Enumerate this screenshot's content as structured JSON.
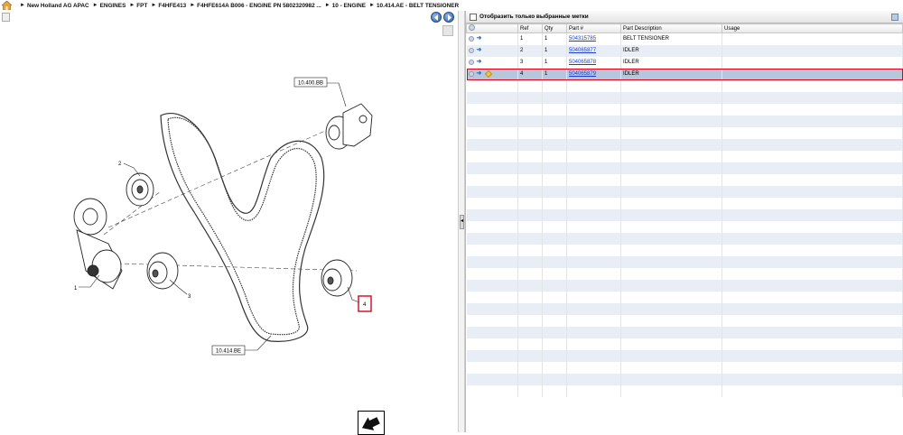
{
  "breadcrumb": {
    "items": [
      "New Holland AG APAC",
      "ENGINES",
      "FPT",
      "F4HFE413",
      "F4HFE614A B006 - ENGINE PN 5802320982 ...",
      "10 - ENGINE",
      "10.414.AE - BELT TENSIONER"
    ]
  },
  "diagram": {
    "callouts": {
      "ref_10400bb": "10.400.BB",
      "ref_10414be": "10.414.BE",
      "item_1": "1",
      "item_2": "2",
      "item_3": "3",
      "item_4": "4"
    }
  },
  "parts_panel": {
    "filter_label": "Отобразить только выбранные метки",
    "columns": [
      "",
      "Ref",
      "Qty",
      "Part #",
      "Part Description",
      "Usage"
    ],
    "rows": [
      {
        "ref": "1",
        "qty": "1",
        "part": "504315785",
        "desc": "BELT TENSIONER",
        "usage": "",
        "selected": false
      },
      {
        "ref": "2",
        "qty": "1",
        "part": "504065877",
        "desc": "IDLER",
        "usage": "",
        "selected": false
      },
      {
        "ref": "3",
        "qty": "1",
        "part": "504065878",
        "desc": "IDLER",
        "usage": "",
        "selected": false
      },
      {
        "ref": "4",
        "qty": "1",
        "part": "504065879",
        "desc": "IDLER",
        "usage": "",
        "selected": true
      }
    ],
    "empty_rows": 27
  },
  "colors": {
    "selection_outline": "#e0001a",
    "stripe": "#e9eef6",
    "selected_row": "#b8c6dc",
    "link": "#1a3fcf"
  }
}
